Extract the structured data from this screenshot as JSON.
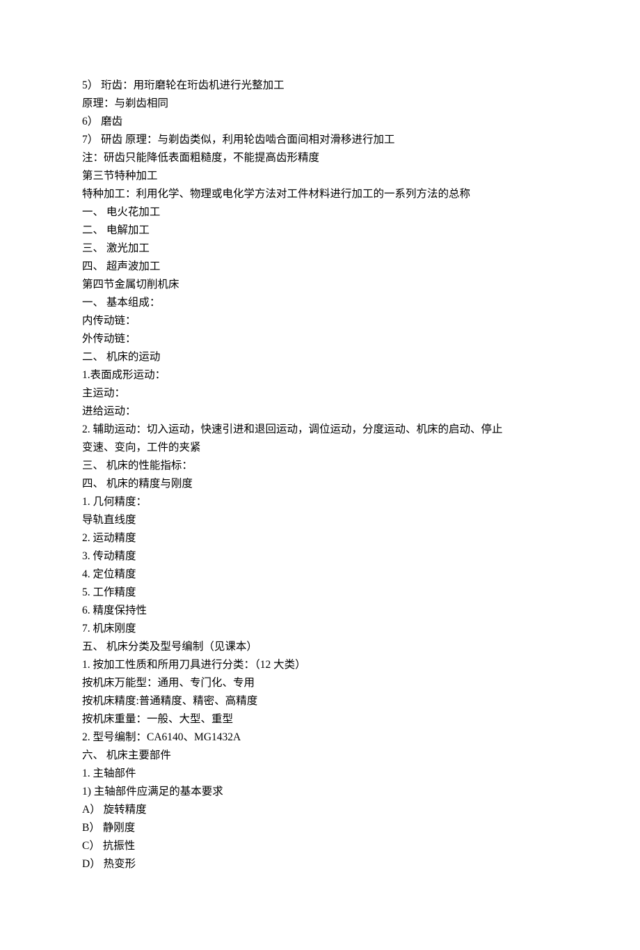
{
  "lines": [
    "5）  珩齿：用珩磨轮在珩齿机进行光整加工",
    "原理：与剃齿相同",
    "6）  磨齿",
    "7）  研齿        原理：与剃齿类似，利用轮齿啮合面间相对滑移进行加工",
    "注：研齿只能降低表面粗糙度，不能提高齿形精度",
    "第三节特种加工",
    "特种加工：利用化学、物理或电化学方法对工件材料进行加工的一系列方法的总称",
    "一、        电火花加工",
    "二、        电解加工",
    "三、        激光加工",
    "四、        超声波加工",
    "第四节金属切削机床",
    "一、        基本组成：",
    "内传动链：",
    "外传动链：",
    "二、        机床的运动",
    "1.表面成形运动：",
    "主运动：",
    "进给运动：",
    "2.    辅助运动：切入运动，快速引进和退回运动，调位运动，分度运动、机床的启动、停止",
    "变速、变向，工件的夹紧",
    "三、        机床的性能指标：",
    "四、        机床的精度与刚度",
    "1.    几何精度：",
    "导轨直线度",
    "2.    运动精度",
    "3.    传动精度",
    "4.    定位精度",
    "5.    工作精度",
    "6.    精度保持性",
    "7.    机床刚度",
    "五、        机床分类及型号编制（见课本）",
    "1.    按加工性质和所用刀具进行分类：（12 大类）",
    "按机床万能型：通用、专门化、专用",
    "按机床精度:普通精度、精密、高精度",
    "按机床重量：一般、大型、重型",
    "2.    型号编制：CA6140、MG1432A",
    "六、        机床主要部件",
    "1.    主轴部件",
    "1)    主轴部件应满足的基本要求",
    "A）  旋转精度",
    "B）  静刚度",
    "C）  抗振性",
    "D）  热变形"
  ]
}
